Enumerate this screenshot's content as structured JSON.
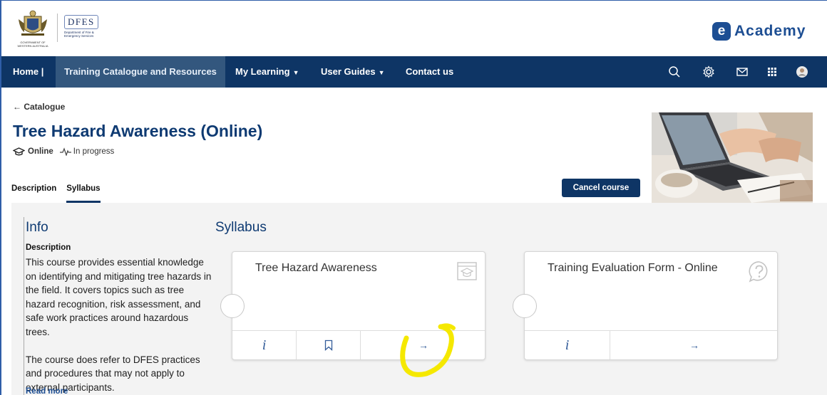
{
  "header": {
    "crest_caption": "GOVERNMENT OF WESTERN AUSTRALIA",
    "dfes_logo": "DFES",
    "dfes_subtitle": "Department of Fire & Emergency Services",
    "academy_letter": "e",
    "academy_word": "Academy"
  },
  "nav": {
    "home": "Home |",
    "training": "Training Catalogue and Resources",
    "my_learning": "My Learning",
    "user_guides": "User Guides",
    "contact": "Contact us",
    "icons": [
      "search-icon",
      "gear-icon",
      "mail-icon",
      "apps-grid-icon",
      "user-avatar"
    ]
  },
  "course": {
    "breadcrumb": "← Catalogue",
    "title": "Tree Hazard Awareness (Online)",
    "mode": "Online",
    "status": "In progress",
    "tabs": [
      "Description",
      "Syllabus"
    ],
    "active_tab": "Syllabus",
    "cancel_label": "Cancel course"
  },
  "info": {
    "heading": "Info",
    "description_label": "Description",
    "paragraph1": "This course provides essential knowledge on identifying and mitigating tree hazards in the field. It covers topics such as tree hazard recognition, risk assessment, and safe work practices around hazardous trees.",
    "paragraph2": "The course does refer to DFES practices and procedures that may not apply to external participants.",
    "read_more": "Read more"
  },
  "syllabus": {
    "heading": "Syllabus",
    "cards": [
      {
        "title": "Tree Hazard Awareness",
        "icon": "course-module-icon",
        "info": "i",
        "bookmark": "bookmark-icon",
        "arrow": "→"
      },
      {
        "title": "Training Evaluation Form - Online",
        "icon": "question-icon",
        "info": "i",
        "arrow": "→"
      }
    ]
  },
  "colors": {
    "nav_bg": "#0e3565",
    "nav_active": "#33577e",
    "title": "#0e3a72",
    "brand": "#1d4e93",
    "highlight": "#f5e800"
  }
}
